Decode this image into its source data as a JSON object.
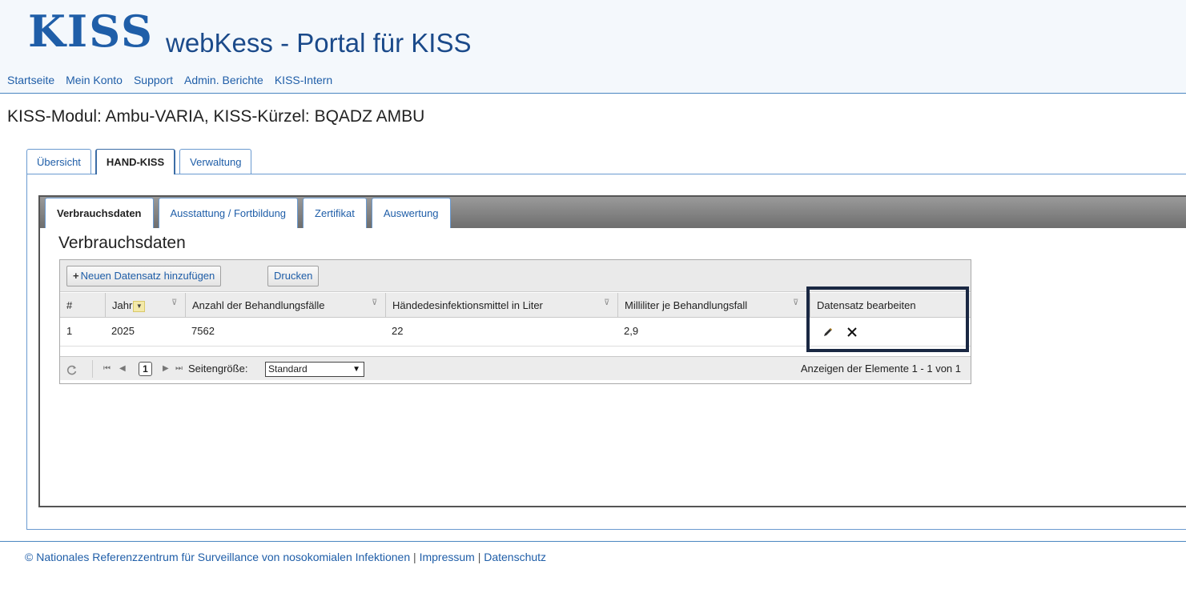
{
  "header": {
    "logo_text": "KISS",
    "title": "webKess - Portal für KISS",
    "nav": [
      "Startseite",
      "Mein Konto",
      "Support",
      "Admin. Berichte",
      "KISS-Intern"
    ]
  },
  "module_title": "KISS-Modul: Ambu-VARIA, KISS-Kürzel: BQADZ AMBU",
  "outer_tabs": [
    "Übersicht",
    "HAND-KISS",
    "Verwaltung"
  ],
  "inner_tabs": [
    "Verbrauchsdaten",
    "Ausstattung / Fortbildung",
    "Zertifikat",
    "Auswertung"
  ],
  "section_title": "Verbrauchsdaten",
  "toolbar": {
    "add_label": "Neuen Datensatz hinzufügen",
    "print_label": "Drucken"
  },
  "columns": [
    "#",
    "Jahr",
    "Anzahl der Behandlungsfälle",
    "Händedesinfektionsmittel in Liter",
    "Milliliter je Behandlungsfall",
    "Datensatz bearbeiten"
  ],
  "rows": [
    [
      "1",
      "2025",
      "7562",
      "22",
      "2,9"
    ]
  ],
  "pager": {
    "current_page": "1",
    "page_size_label": "Seitengröße:",
    "page_size_value": "Standard",
    "summary": "Anzeigen der Elemente 1 - 1 von 1"
  },
  "footer": {
    "copyright": "© Nationales Referenzzentrum für Surveillance von nosokomialen Infektionen",
    "sep": "|",
    "impressum": "Impressum",
    "datenschutz": "Datenschutz"
  },
  "colors": {
    "accent": "#1f5ea8",
    "highlight_frame": "#1a2843"
  }
}
